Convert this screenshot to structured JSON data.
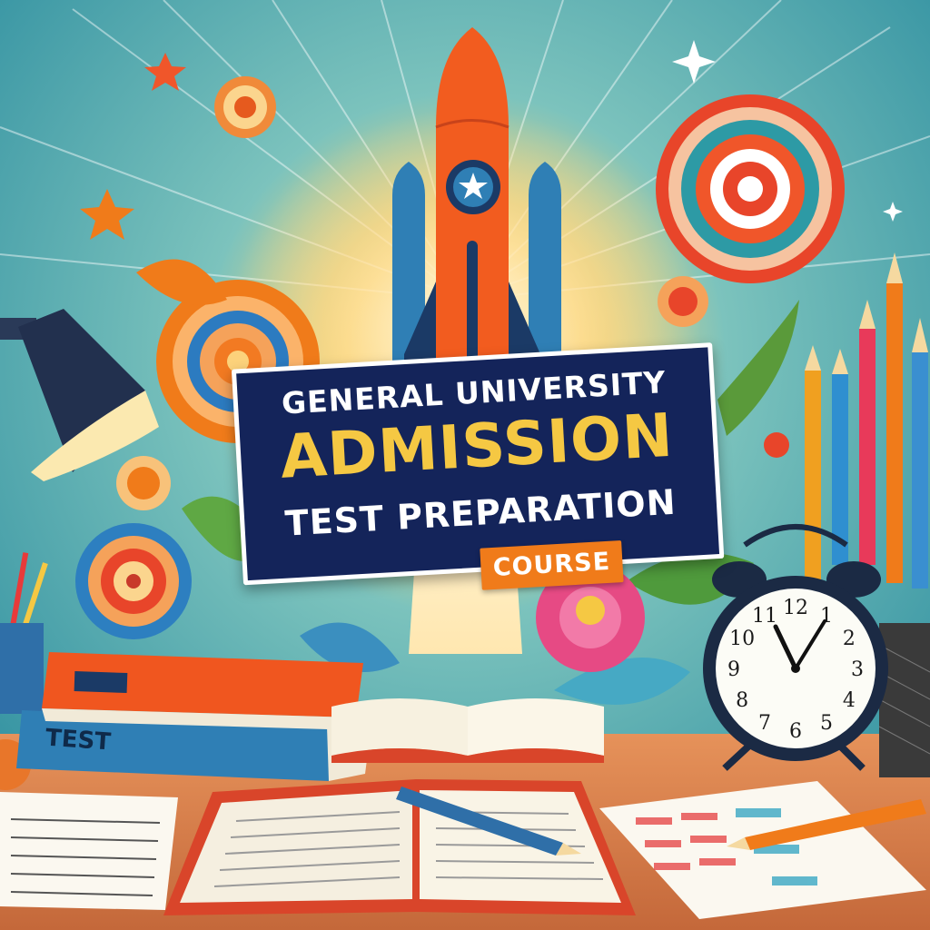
{
  "banner": {
    "line1": "GENERAL UNIVERSITY",
    "line2": "ADMISSION",
    "line3": "TEST PREPARATION",
    "tag": "COURSE"
  },
  "book": {
    "spine_label": "TEST"
  },
  "clock": {
    "numbers": [
      "12",
      "1",
      "2",
      "3",
      "4",
      "5",
      "6",
      "7",
      "8",
      "9",
      "10",
      "11"
    ]
  },
  "colors": {
    "sky": "#3d9aa6",
    "banner_navy": "#14245a",
    "banner_gold": "#f5c843",
    "accent_orange": "#f07b1a",
    "rocket_orange": "#f25c1f",
    "desk_wood": "#d9814a"
  }
}
